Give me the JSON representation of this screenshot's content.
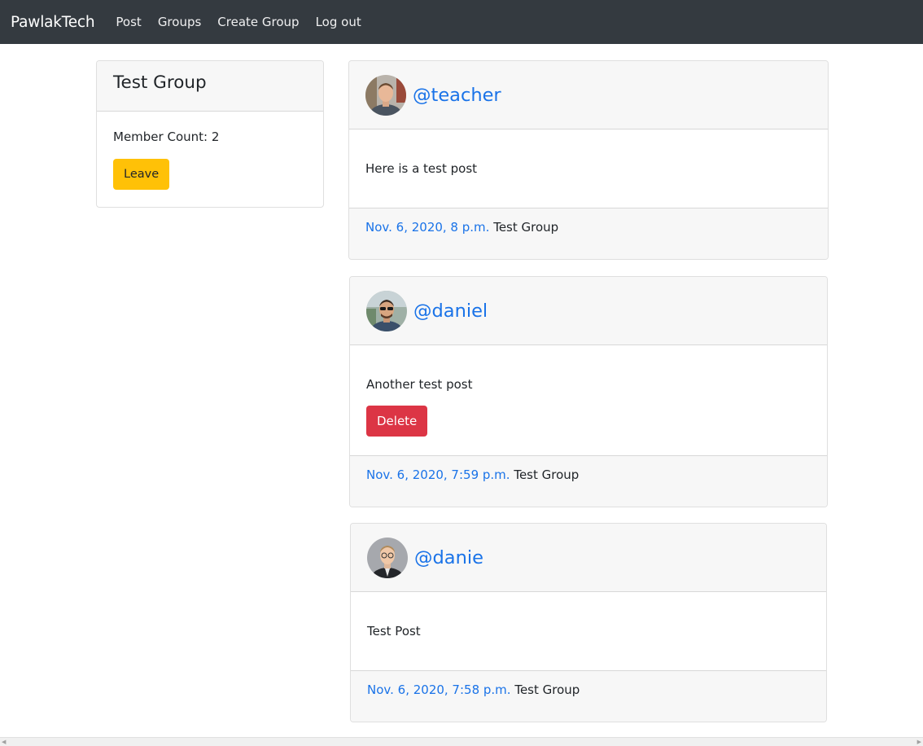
{
  "navbar": {
    "brand": "PawlakTech",
    "links": [
      "Post",
      "Groups",
      "Create Group",
      "Log out"
    ],
    "background": "#343a40"
  },
  "group": {
    "title": "Test Group",
    "member_count": "Member Count: 2",
    "leave_label": "Leave"
  },
  "posts": [
    {
      "username": "@teacher",
      "text": "Here is a test post",
      "date": "Nov. 6, 2020, 8 p.m.",
      "group": "Test Group",
      "avatar": "avatar-photo"
    },
    {
      "username": "@daniel",
      "text": "Another test post",
      "delete_label": "Delete",
      "date": "Nov. 6, 2020, 7:59 p.m.",
      "group": "Test Group",
      "avatar": "avatar-photo"
    },
    {
      "username": "@danie",
      "text": "Test Post",
      "date": "Nov. 6, 2020, 7:58 p.m.",
      "group": "Test Group",
      "avatar": "avatar-photo"
    }
  ],
  "colors": {
    "link": "#1a73e8",
    "warning": "#ffc107",
    "danger": "#dc3545",
    "card_header": "#f7f7f7"
  }
}
